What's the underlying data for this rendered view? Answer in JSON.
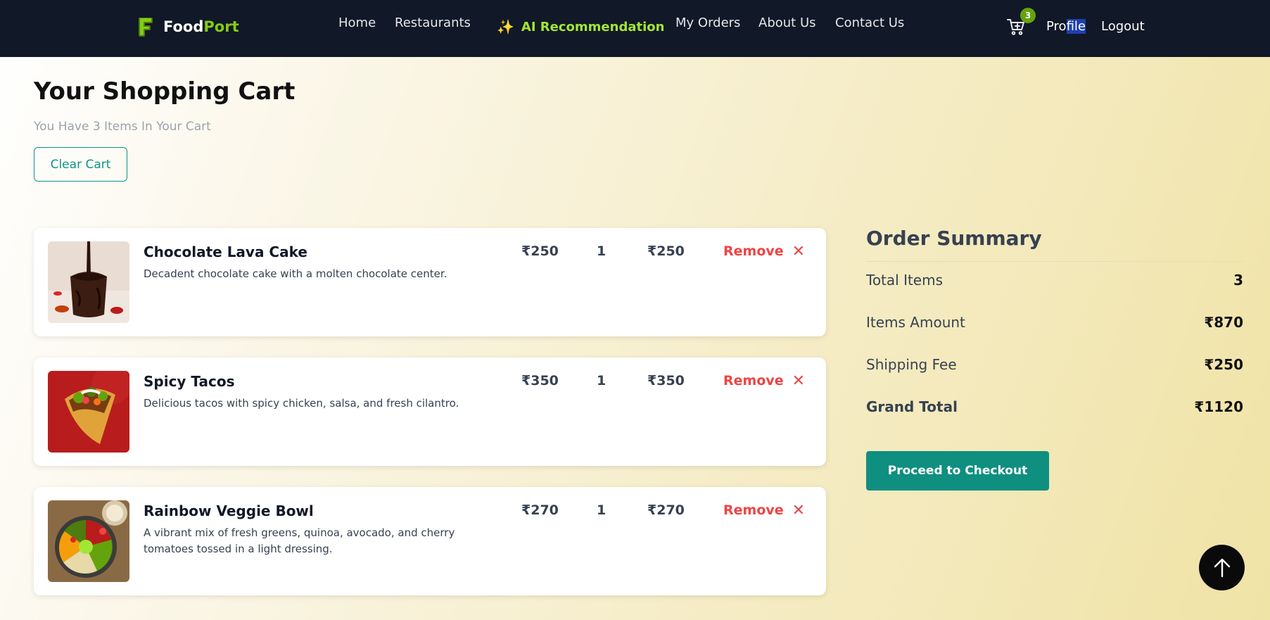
{
  "navbar": {
    "logo": {
      "part1": "Food",
      "part2": "Port",
      "icon": "letter-f-logo-icon"
    },
    "links": [
      "Home",
      "Restaurants",
      "My Orders",
      "About Us",
      "Contact Us"
    ],
    "ai": {
      "icon": "sparkles-icon",
      "label": "AI Recommendation"
    },
    "cart": {
      "icon": "cart-icon",
      "count": "3"
    },
    "profile": {
      "before": "Pro",
      "selected": "file"
    },
    "logout": "Logout"
  },
  "page": {
    "title": "Your Shopping Cart",
    "subtitle": "You Have 3 Items In Your Cart",
    "clear_label": "Clear Cart"
  },
  "items": [
    {
      "name": "Chocolate Lava Cake",
      "description": "Decadent chocolate cake with a molten chocolate center.",
      "price": "₹250",
      "quantity": "1",
      "total": "₹250",
      "remove_label": "Remove",
      "remove_icon": "close-icon"
    },
    {
      "name": "Spicy Tacos",
      "description": "Delicious tacos with spicy chicken, salsa, and fresh cilantro.",
      "price": "₹350",
      "quantity": "1",
      "total": "₹350",
      "remove_label": "Remove",
      "remove_icon": "close-icon"
    },
    {
      "name": "Rainbow Veggie Bowl",
      "description": "A vibrant mix of fresh greens, quinoa, avocado, and cherry tomatoes tossed in a light dressing.",
      "price": "₹270",
      "quantity": "1",
      "total": "₹270",
      "remove_label": "Remove",
      "remove_icon": "close-icon"
    }
  ],
  "summary": {
    "title": "Order Summary",
    "rows": [
      {
        "label": "Total Items",
        "value": "3"
      },
      {
        "label": "Items Amount",
        "value": "₹870"
      },
      {
        "label": "Shipping Fee",
        "value": "₹250"
      },
      {
        "label": "Grand Total",
        "value": "₹1120"
      }
    ],
    "checkout_label": "Proceed to Checkout"
  },
  "scroll_top_icon": "arrow-up-icon",
  "colors": {
    "nav_bg": "#111827",
    "accent_green": "#84cc16",
    "teal": "#0f8f80",
    "remove_red": "#ef4444"
  }
}
